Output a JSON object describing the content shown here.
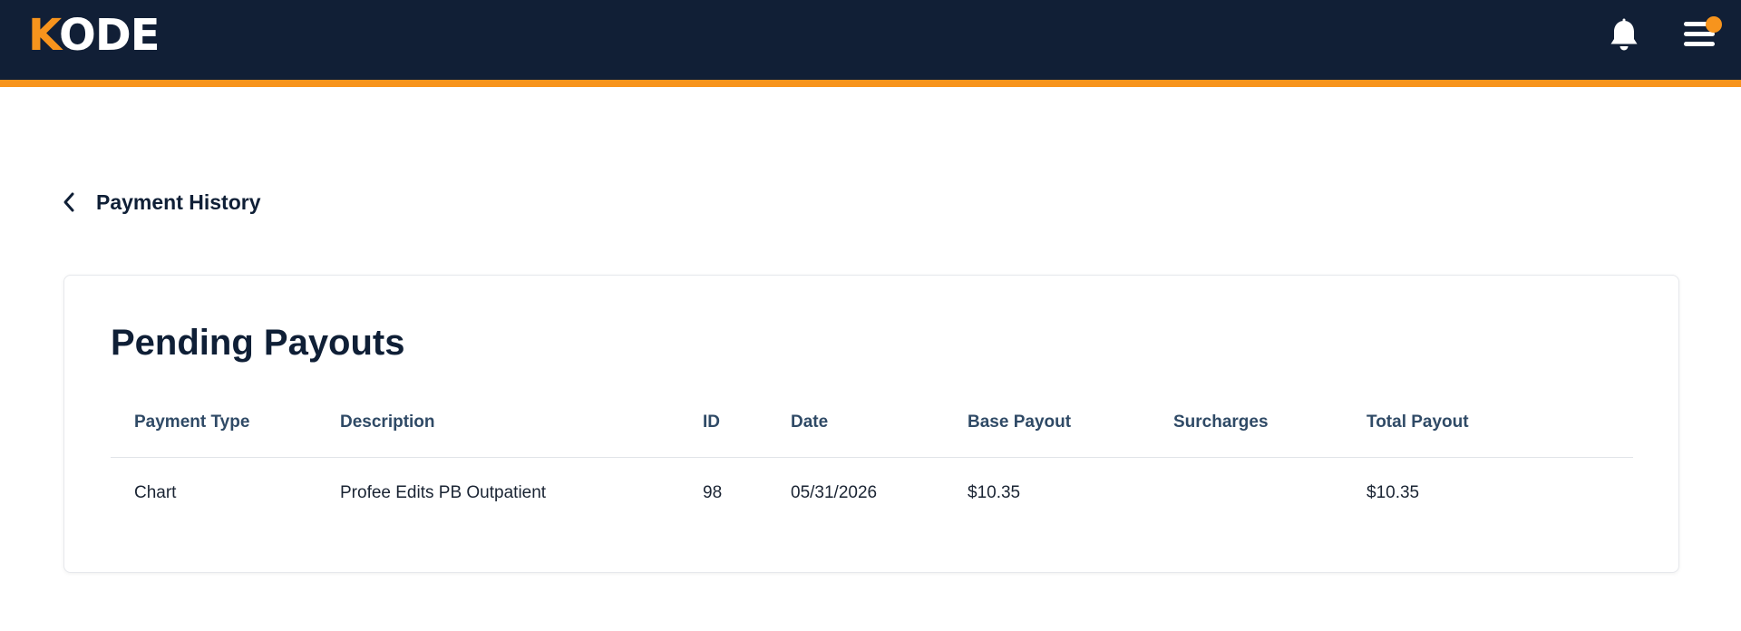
{
  "header": {
    "logo_first": "K",
    "logo_rest": "ODE",
    "brand_color": "#f7941d",
    "bar_color": "#111f36",
    "notifications_icon": "bell-icon",
    "menu_icon": "hamburger-menu-icon"
  },
  "page": {
    "back_label": "Payment History"
  },
  "card": {
    "title": "Pending Payouts",
    "columns": [
      "Payment Type",
      "Description",
      "ID",
      "Date",
      "Base Payout",
      "Surcharges",
      "Total Payout"
    ],
    "rows": [
      [
        "Chart",
        "Profee Edits PB Outpatient",
        "98",
        "05/31/2026",
        "$10.35",
        "",
        "$10.35"
      ]
    ]
  }
}
